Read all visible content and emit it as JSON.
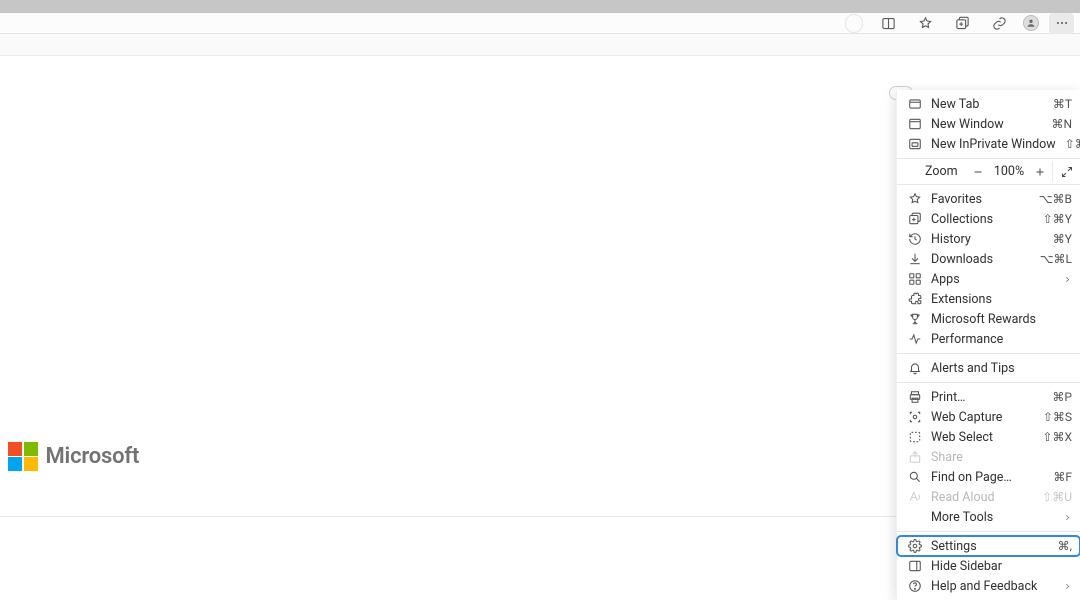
{
  "toolbar": {},
  "logo": {
    "text": "Microsoft"
  },
  "zoom": {
    "label": "Zoom",
    "value": "100%"
  },
  "menu": {
    "newTab": {
      "label": "New Tab",
      "shortcut": "⌘T"
    },
    "newWindow": {
      "label": "New Window",
      "shortcut": "⌘N"
    },
    "newInPrivate": {
      "label": "New InPrivate Window",
      "shortcut": "⇧⌘N"
    },
    "favorites": {
      "label": "Favorites",
      "shortcut": "⌥⌘B"
    },
    "collections": {
      "label": "Collections",
      "shortcut": "⇧⌘Y"
    },
    "history": {
      "label": "History",
      "shortcut": "⌘Y"
    },
    "downloads": {
      "label": "Downloads",
      "shortcut": "⌥⌘L"
    },
    "apps": {
      "label": "Apps"
    },
    "extensions": {
      "label": "Extensions"
    },
    "rewards": {
      "label": "Microsoft Rewards"
    },
    "performance": {
      "label": "Performance"
    },
    "alerts": {
      "label": "Alerts and Tips"
    },
    "print": {
      "label": "Print…",
      "shortcut": "⌘P"
    },
    "webCapture": {
      "label": "Web Capture",
      "shortcut": "⇧⌘S"
    },
    "webSelect": {
      "label": "Web Select",
      "shortcut": "⇧⌘X"
    },
    "share": {
      "label": "Share"
    },
    "find": {
      "label": "Find on Page…",
      "shortcut": "⌘F"
    },
    "readAloud": {
      "label": "Read Aloud",
      "shortcut": "⇧⌘U"
    },
    "moreTools": {
      "label": "More Tools"
    },
    "settings": {
      "label": "Settings",
      "shortcut": "⌘,"
    },
    "hideSidebar": {
      "label": "Hide Sidebar"
    },
    "help": {
      "label": "Help and Feedback"
    }
  }
}
